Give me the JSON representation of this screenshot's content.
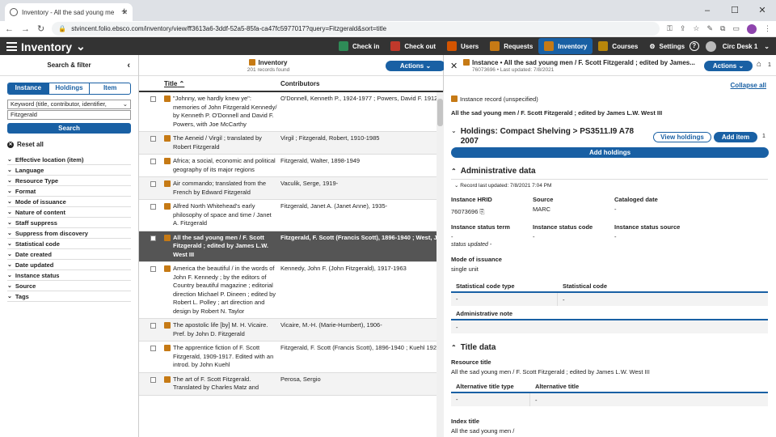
{
  "browser": {
    "tab_title": "Inventory - All the sad young me",
    "url": "stvincent.folio.ebsco.com/inventory/view/ff3613a6-3ddf-52a5-85fa-ca47fc5977017?query=Fitzgerald&sort=title",
    "new_tab": "+",
    "win_min": "–",
    "win_max": "☐",
    "win_close": "✕"
  },
  "header": {
    "app_name": "Inventory",
    "nav": [
      {
        "label": "Check in",
        "color": "#2e8b57"
      },
      {
        "label": "Check out",
        "color": "#c0392b"
      },
      {
        "label": "Users",
        "color": "#d35400"
      },
      {
        "label": "Requests",
        "color": "#c67a15"
      },
      {
        "label": "Inventory",
        "color": "#c67a15"
      },
      {
        "label": "Courses",
        "color": "#b8860b"
      },
      {
        "label": "Settings",
        "color": "#333"
      }
    ],
    "help": "?",
    "service_point": "Circ Desk 1"
  },
  "filter": {
    "title": "Search & filter",
    "segments": [
      "Instance",
      "Holdings",
      "Item"
    ],
    "keyword_option": "Keyword (title, contributor, identifier,",
    "query": "Fitzgerald",
    "search_label": "Search",
    "reset_label": "Reset all",
    "facets": [
      "Effective location (item)",
      "Language",
      "Resource Type",
      "Format",
      "Mode of issuance",
      "Nature of content",
      "Staff suppress",
      "Suppress from discovery",
      "Statistical code",
      "Date created",
      "Date updated",
      "Instance status",
      "Source",
      "Tags"
    ]
  },
  "results": {
    "title": "Inventory",
    "count": "201 records found",
    "actions": "Actions",
    "col_title": "Title",
    "col_contrib": "Contributors",
    "rows": [
      {
        "title": "\"Johnny, we hardly knew ye\": memories of John Fitzgerald Kennedy/ by Kenneth P. O'Donnell and David F. Powers, with Joe McCarthy",
        "contrib": "O'Donnell, Kenneth P., 1924-1977 ; Powers, David F. 1912-"
      },
      {
        "title": "The Aeneid / Virgil ; translated by Robert Fitzgerald",
        "contrib": "Virgil ; Fitzgerald, Robert, 1910-1985"
      },
      {
        "title": "Africa; a social, economic and political geography of its major regions",
        "contrib": "Fitzgerald, Walter, 1898-1949"
      },
      {
        "title": "Air commando; translated from the French by Edward Fitzgerald",
        "contrib": "Vaculik, Serge, 1919-"
      },
      {
        "title": "Alfred North Whitehead's early philosophy of space and time / Janet A. Fitzgerald",
        "contrib": "Fitzgerald, Janet A. (Janet Anne), 1935-"
      },
      {
        "title": "All the sad young men / F. Scott Fitzgerald ; edited by James L.W. West III",
        "contrib": "Fitzgerald, F. Scott (Francis Scott), 1896-1940 ; West, J"
      },
      {
        "title": "America the beautiful / in the words of John F. Kennedy ; by the editors of Country beautiful magazine ; editorial direction Michael P. Dineen ; edited by Robert L. Polley ; art direction and design by Robert N. Taylor",
        "contrib": "Kennedy, John F. (John Fitzgerald), 1917-1963"
      },
      {
        "title": "The apostolic life [by] M. H. Vicaire. Pref. by John D. Fitzgerald",
        "contrib": "Vicaire, M.-H. (Marie-Humbert), 1906-"
      },
      {
        "title": "The apprentice fiction of F. Scott Fitzgerald, 1909-1917. Edited with an introd. by John Kuehl",
        "contrib": "Fitzgerald, F. Scott (Francis Scott), 1896-1940 ; Kuehl 1928-"
      },
      {
        "title": "The art of F. Scott Fitzgerald. Translated by Charles Matz and",
        "contrib": "Perosa, Sergio"
      }
    ],
    "selected_index": 5
  },
  "detail": {
    "title": "Instance • All the sad young men / F. Scott Fitzgerald ; edited by James...",
    "sub": "76073696 • Last updated: 7/8/2021",
    "actions": "Actions",
    "tag_count": "1",
    "collapse_all": "Collapse all",
    "record_type": "Instance record (unspecified)",
    "full_title": "All the sad young men / F. Scott Fitzgerald ; edited by James L.W. West III",
    "holdings_heading": "Holdings: Compact Shelving > PS3511.I9 A78 2007",
    "view_holdings": "View holdings",
    "add_item": "Add item",
    "holdings_count": "1",
    "add_holdings": "Add holdings",
    "admin_heading": "Administrative data",
    "record_updated": "Record last updated: 7/8/2021 7:04 PM",
    "hrid_label": "Instance HRID",
    "hrid_value": "76073696",
    "source_label": "Source",
    "source_value": "MARC",
    "cataloged_label": "Cataloged date",
    "cataloged_value": "-",
    "status_term_label": "Instance status term",
    "status_term_value": "-",
    "status_code_label": "Instance status code",
    "status_code_value": "-",
    "status_source_label": "Instance status source",
    "status_source_value": "-",
    "status_updated": "status updated -",
    "mode_label": "Mode of issuance",
    "mode_value": "single unit",
    "stat_type_label": "Statistical code type",
    "stat_code_label": "Statistical code",
    "stat_type_value": "-",
    "stat_code_value": "-",
    "admin_note_label": "Administrative note",
    "admin_note_value": "-",
    "title_heading": "Title data",
    "resource_title_label": "Resource title",
    "resource_title_value": "All the sad young men / F. Scott Fitzgerald ; edited by James L.W. West III",
    "alt_type_label": "Alternative title type",
    "alt_title_label": "Alternative title",
    "alt_type_value": "-",
    "alt_title_value": "-",
    "index_title_label": "Index title",
    "index_title_value": "All the sad young men /"
  }
}
